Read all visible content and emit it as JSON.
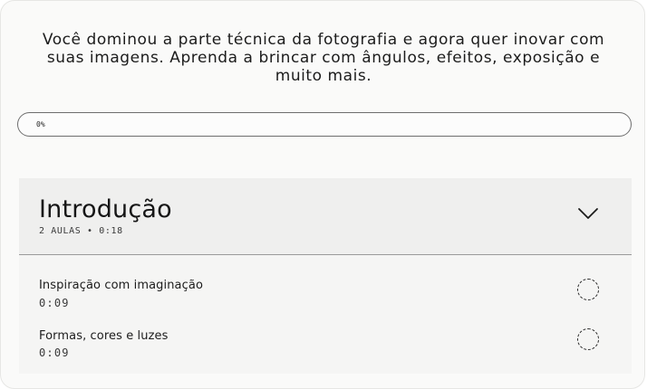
{
  "course": {
    "description": "Você dominou a parte técnica da fotografia e agora quer inovar com suas imagens. Aprenda a brincar com ângulos, efeitos, exposição e muito mais."
  },
  "progress": {
    "label": "0%",
    "value_percent": 0
  },
  "module": {
    "title": "Introdução",
    "meta": "2 AULAS • 0:18",
    "expanded": true,
    "toggle_icon": "chevron-down-icon"
  },
  "lessons": [
    {
      "title": "Inspiração com imaginação",
      "duration": "0:09",
      "status_icon": "incomplete-circle-icon"
    },
    {
      "title": "Formas, cores e luzes",
      "duration": "0:09",
      "status_icon": "incomplete-circle-icon"
    }
  ]
}
